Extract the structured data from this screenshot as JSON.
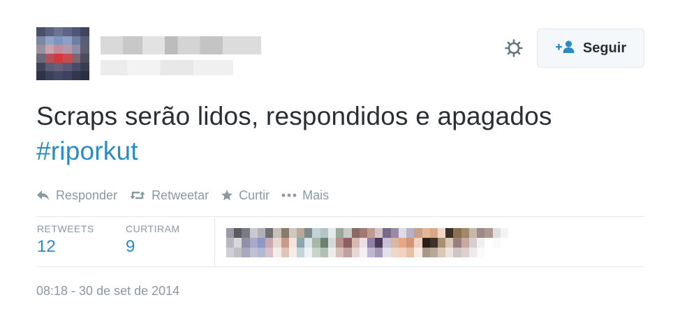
{
  "tweet": {
    "text": "Scraps serão lidos, respondidos e apagados",
    "hashtag": "#riporkut",
    "follow_label": "Seguir",
    "actions": {
      "reply": "Responder",
      "retweet": "Retweetar",
      "like": "Curtir",
      "more": "Mais"
    },
    "stats": {
      "retweets_label": "RETWEETS",
      "retweets_count": "12",
      "likes_label": "CURTIRAM",
      "likes_count": "9"
    },
    "timestamp": "08:18 - 30 de set de 2014"
  },
  "colors": {
    "text": "#292f33",
    "link": "#2b8cc4",
    "muted": "#8899a6",
    "border": "#e1e8ed",
    "follow_icon": "#2b8cc4"
  },
  "icons": [
    "gear-icon",
    "follow-person-icon",
    "reply-icon",
    "retweet-icon",
    "star-icon",
    "more-dots-icon"
  ]
}
